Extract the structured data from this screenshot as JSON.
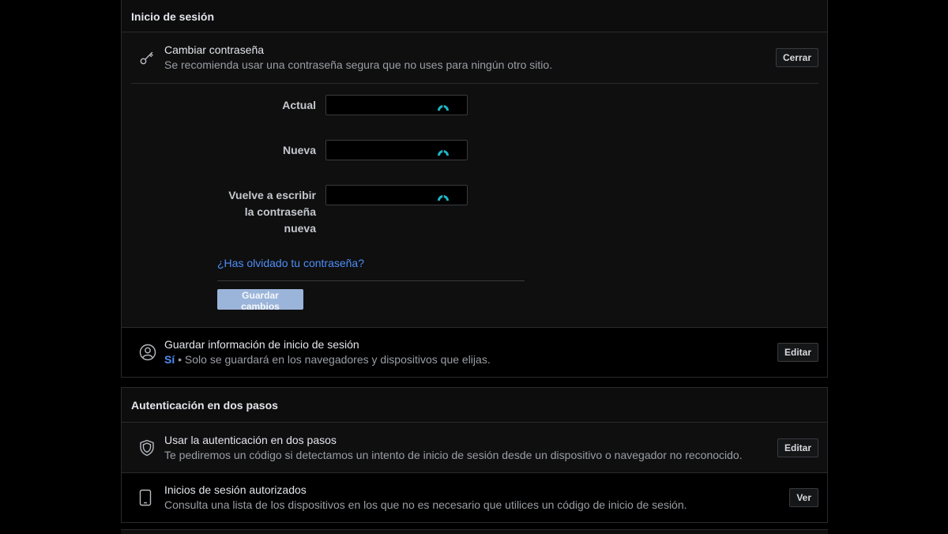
{
  "login": {
    "header": "Inicio de sesión",
    "change_password": {
      "title": "Cambiar contraseña",
      "subtitle": "Se recomienda usar una contraseña segura que no uses para ningún otro sitio.",
      "button": "Cerrar"
    },
    "form": {
      "current_label": "Actual",
      "new_label": "Nueva",
      "retype_label_lines": [
        "Vuelve a escribir",
        "la contraseña",
        "nueva"
      ],
      "forgot_link": "¿Has olvidado tu contraseña?",
      "save_button": "Guardar cambios"
    },
    "save_login_info": {
      "title": "Guardar información de inicio de sesión",
      "value": "Sí",
      "subtitle": " • Solo se guardará en los navegadores y dispositivos que elijas.",
      "button": "Editar"
    }
  },
  "two_factor": {
    "header": "Autenticación en dos pasos",
    "use_2fa": {
      "title": "Usar la autenticación en dos pasos",
      "subtitle": "Te pediremos un código si detectamos un intento de inicio de sesión desde un dispositivo o navegador no reconocido.",
      "button": "Editar"
    },
    "authorized_logins": {
      "title": "Inicios de sesión autorizados",
      "subtitle": "Consulta una lista de los dispositivos en los que no es necesario que utilices un código de inicio de sesión.",
      "button": "Ver"
    }
  },
  "icons": {
    "key": "key-icon",
    "user_circle": "user-circle-icon",
    "shield": "shield-icon",
    "phone": "phone-icon",
    "password_manager": "password-manager-icon"
  },
  "colors": {
    "link": "#4e8ef5",
    "accent_eye": "#1fb5c4",
    "save_disabled": "#9bb4d9"
  }
}
